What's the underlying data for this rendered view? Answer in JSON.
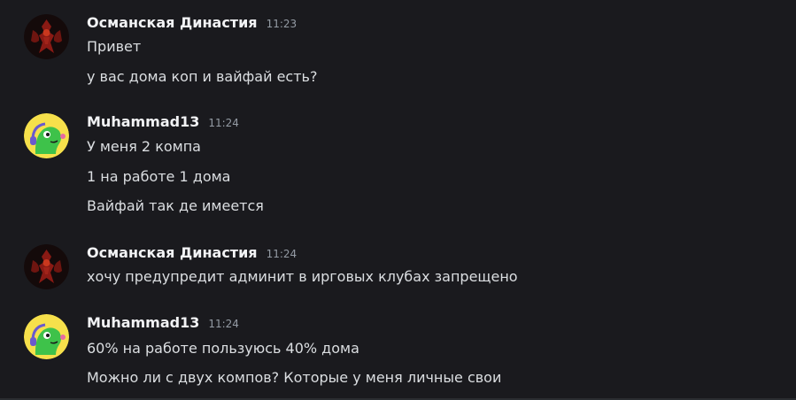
{
  "messages": [
    {
      "author": "Османская Династия",
      "time": "11:23",
      "avatar": "dark-red-emblem-icon",
      "lines": [
        "Привет",
        "у вас дома коп и вайфай есть?"
      ]
    },
    {
      "author": "Muhammad13",
      "time": "11:24",
      "avatar": "green-cartoon-headset-icon",
      "lines": [
        "У меня 2 компа",
        "1 на работе 1 дома",
        "Вайфай так де имеется"
      ]
    },
    {
      "author": "Османская Династия",
      "time": "11:24",
      "avatar": "dark-red-emblem-icon",
      "lines": [
        "хочу предупредит админит в ирговых клубах запрещено"
      ]
    },
    {
      "author": "Muhammad13",
      "time": "11:24",
      "avatar": "green-cartoon-headset-icon",
      "lines": [
        "60% на работе пользуюсь 40% дома",
        "Можно ли с двух компов? Которые у меня личные свои"
      ]
    }
  ],
  "colors": {
    "background": "#1a1a1e",
    "username": "#f2f3f5",
    "timestamp": "#949ba4",
    "text": "#dbdee1",
    "avatar_green_bg": "#f6e04b",
    "avatar_red": "#b3261e"
  }
}
